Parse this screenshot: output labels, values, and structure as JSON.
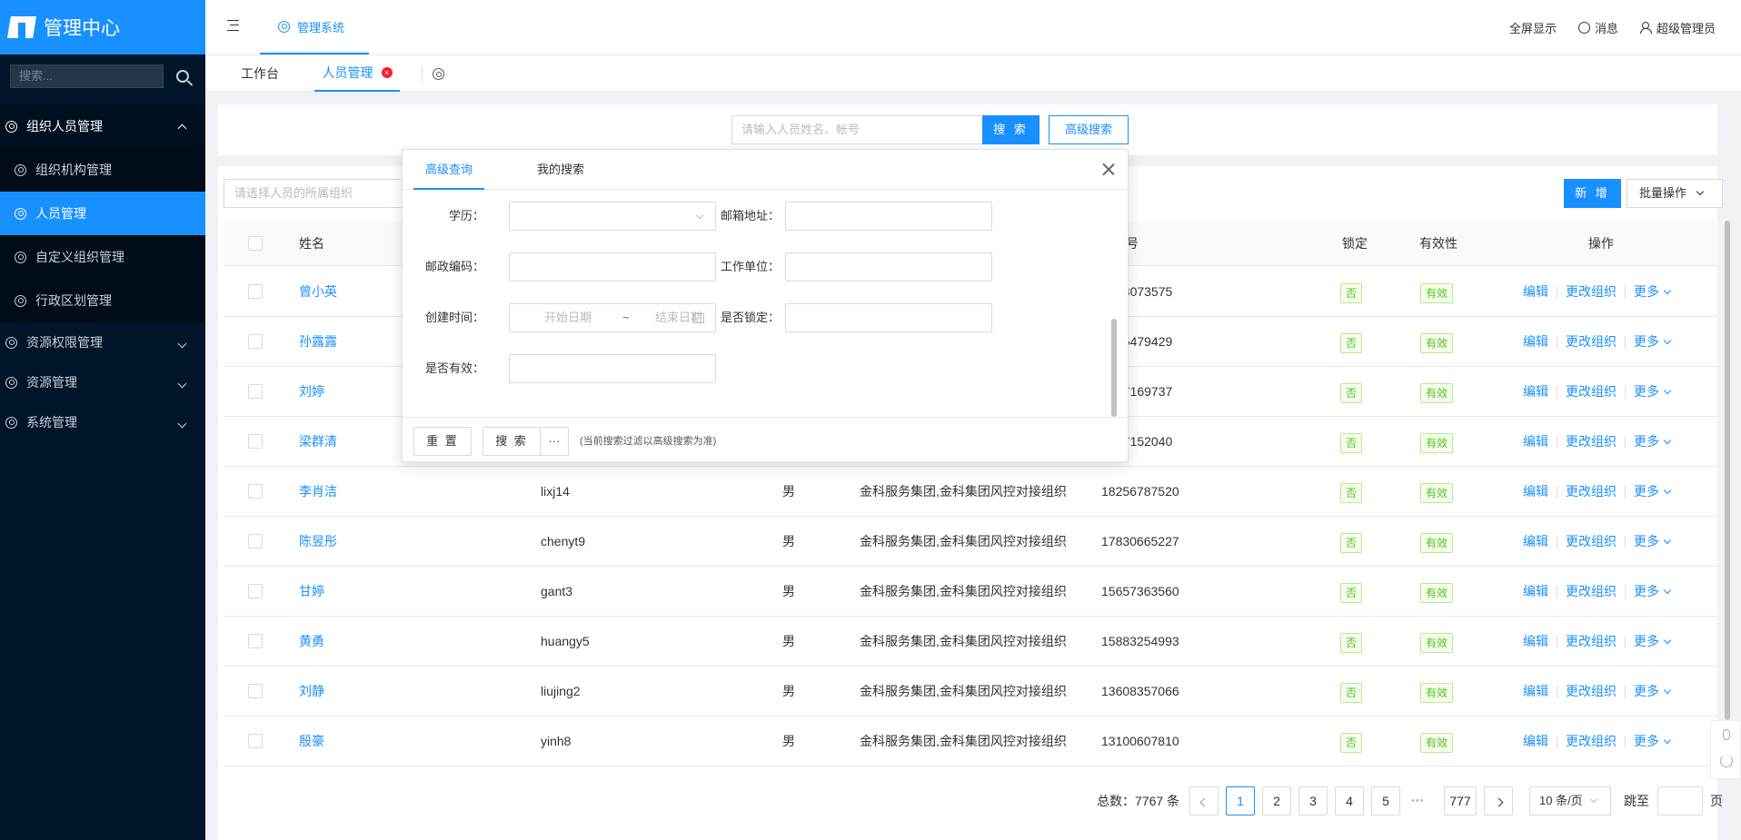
{
  "sidebar": {
    "brand": "管理中心",
    "search_placeholder": "搜索...",
    "groups": [
      {
        "label": "组织人员管理",
        "items": [
          "组织机构管理",
          "人员管理",
          "自定义组织管理",
          "行政区划管理"
        ]
      },
      {
        "label": "资源权限管理"
      },
      {
        "label": "资源管理"
      },
      {
        "label": "系统管理"
      }
    ]
  },
  "header": {
    "nav_tab": "管理系统",
    "fullscreen": "全屏显示",
    "messages": "消息",
    "user": "超级管理员"
  },
  "tabs": [
    "工作台",
    "人员管理"
  ],
  "search": {
    "placeholder": "请输入人员姓名、帐号",
    "button": "搜 索",
    "advanced": "高级搜索"
  },
  "toolbar": {
    "org_placeholder": "请选择人员的所属组织",
    "new_button": "新 增",
    "batch_button": "批量操作"
  },
  "table": {
    "headers": {
      "name": "姓名",
      "phone": "号",
      "lock": "锁定",
      "valid": "有效性",
      "ops": "操作"
    },
    "ops": {
      "edit": "编辑",
      "change_org": "更改组织",
      "more": "更多"
    },
    "rows": [
      {
        "name": "曾小英",
        "account": "",
        "gender": "",
        "org": "",
        "phone": "28073575",
        "lock": "否",
        "valid": "有效"
      },
      {
        "name": "孙露露",
        "account": "",
        "gender": "",
        "org": "",
        "phone": "95479429",
        "lock": "否",
        "valid": "有效"
      },
      {
        "name": "刘婷",
        "account": "",
        "gender": "",
        "org": "",
        "phone": "57169737",
        "lock": "否",
        "valid": "有效"
      },
      {
        "name": "梁群清",
        "account": "",
        "gender": "",
        "org": "",
        "phone": "77152040",
        "lock": "否",
        "valid": "有效"
      },
      {
        "name": "李肖洁",
        "account": "lixj14",
        "gender": "男",
        "org": "金科服务集团,金科集团风控对接组织",
        "phone": "18256787520",
        "lock": "否",
        "valid": "有效"
      },
      {
        "name": "陈昱彤",
        "account": "chenyt9",
        "gender": "男",
        "org": "金科服务集团,金科集团风控对接组织",
        "phone": "17830665227",
        "lock": "否",
        "valid": "有效"
      },
      {
        "name": "甘婷",
        "account": "gant3",
        "gender": "男",
        "org": "金科服务集团,金科集团风控对接组织",
        "phone": "15657363560",
        "lock": "否",
        "valid": "有效"
      },
      {
        "name": "黄勇",
        "account": "huangy5",
        "gender": "男",
        "org": "金科服务集团,金科集团风控对接组织",
        "phone": "15883254993",
        "lock": "否",
        "valid": "有效"
      },
      {
        "name": "刘静",
        "account": "liujing2",
        "gender": "男",
        "org": "金科服务集团,金科集团风控对接组织",
        "phone": "13608357066",
        "lock": "否",
        "valid": "有效"
      },
      {
        "name": "殷豪",
        "account": "yinh8",
        "gender": "男",
        "org": "金科服务集团,金科集团风控对接组织",
        "phone": "13100607810",
        "lock": "否",
        "valid": "有效"
      }
    ]
  },
  "pagination": {
    "total": "总数：7767 条",
    "pages": [
      "1",
      "2",
      "3",
      "4",
      "5"
    ],
    "ellipsis": "•••",
    "last": "777",
    "page_size": "10 条/页",
    "jump_label": "跳至",
    "page_unit": "页"
  },
  "modal": {
    "tabs": [
      "高级查询",
      "我的搜索"
    ],
    "fields": {
      "education": "学历：",
      "email": "邮箱地址：",
      "postcode": "邮政编码：",
      "company": "工作单位：",
      "created": "创建时间：",
      "locked": "是否锁定：",
      "valid": "是否有效："
    },
    "start_date": "开始日期",
    "date_sep": "~",
    "end_date": "结束日期",
    "reset": "重 置",
    "search": "搜 索",
    "more": "···",
    "note": "(当前搜索过滤以高级搜索为准)"
  }
}
